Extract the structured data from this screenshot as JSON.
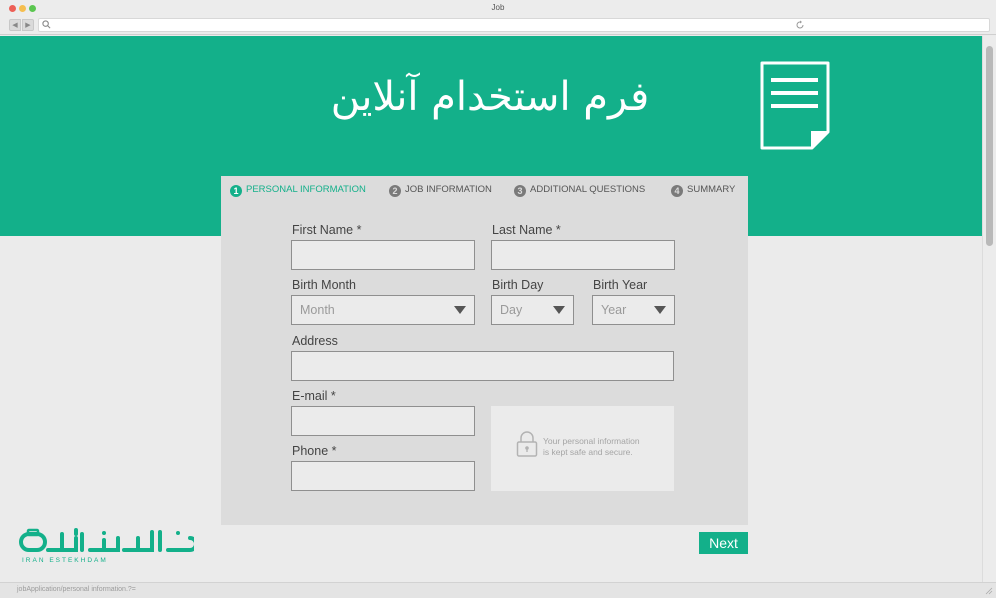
{
  "window": {
    "title": "Job"
  },
  "hero": {
    "title": "فرم استخدام آنلاین"
  },
  "steps": [
    {
      "num": "1",
      "label": "PERSONAL INFORMATION",
      "active": true
    },
    {
      "num": "2",
      "label": "JOB INFORMATION",
      "active": false
    },
    {
      "num": "3",
      "label": "ADDITIONAL QUESTIONS",
      "active": false
    },
    {
      "num": "4",
      "label": "SUMMARY",
      "active": false
    }
  ],
  "form": {
    "first_name_label": "First Name *",
    "last_name_label": "Last Name *",
    "birth_month_label": "Birth Month",
    "birth_month_placeholder": "Month",
    "birth_day_label": "Birth Day",
    "birth_day_placeholder": "Day",
    "birth_year_label": "Birth Year",
    "birth_year_placeholder": "Year",
    "address_label": "Address",
    "email_label": "E-mail *",
    "phone_label": "Phone *",
    "secure_line1": "Your personal information",
    "secure_line2": "is kept safe and secure."
  },
  "actions": {
    "next_label": "Next"
  },
  "logo": {
    "text": "IRAN ESTEKHDAM"
  },
  "statusbar": {
    "text": "jobApplication/personal information.?="
  },
  "colors": {
    "accent": "#13b08a",
    "card": "#dcdcdc",
    "field": "#ebebeb"
  }
}
